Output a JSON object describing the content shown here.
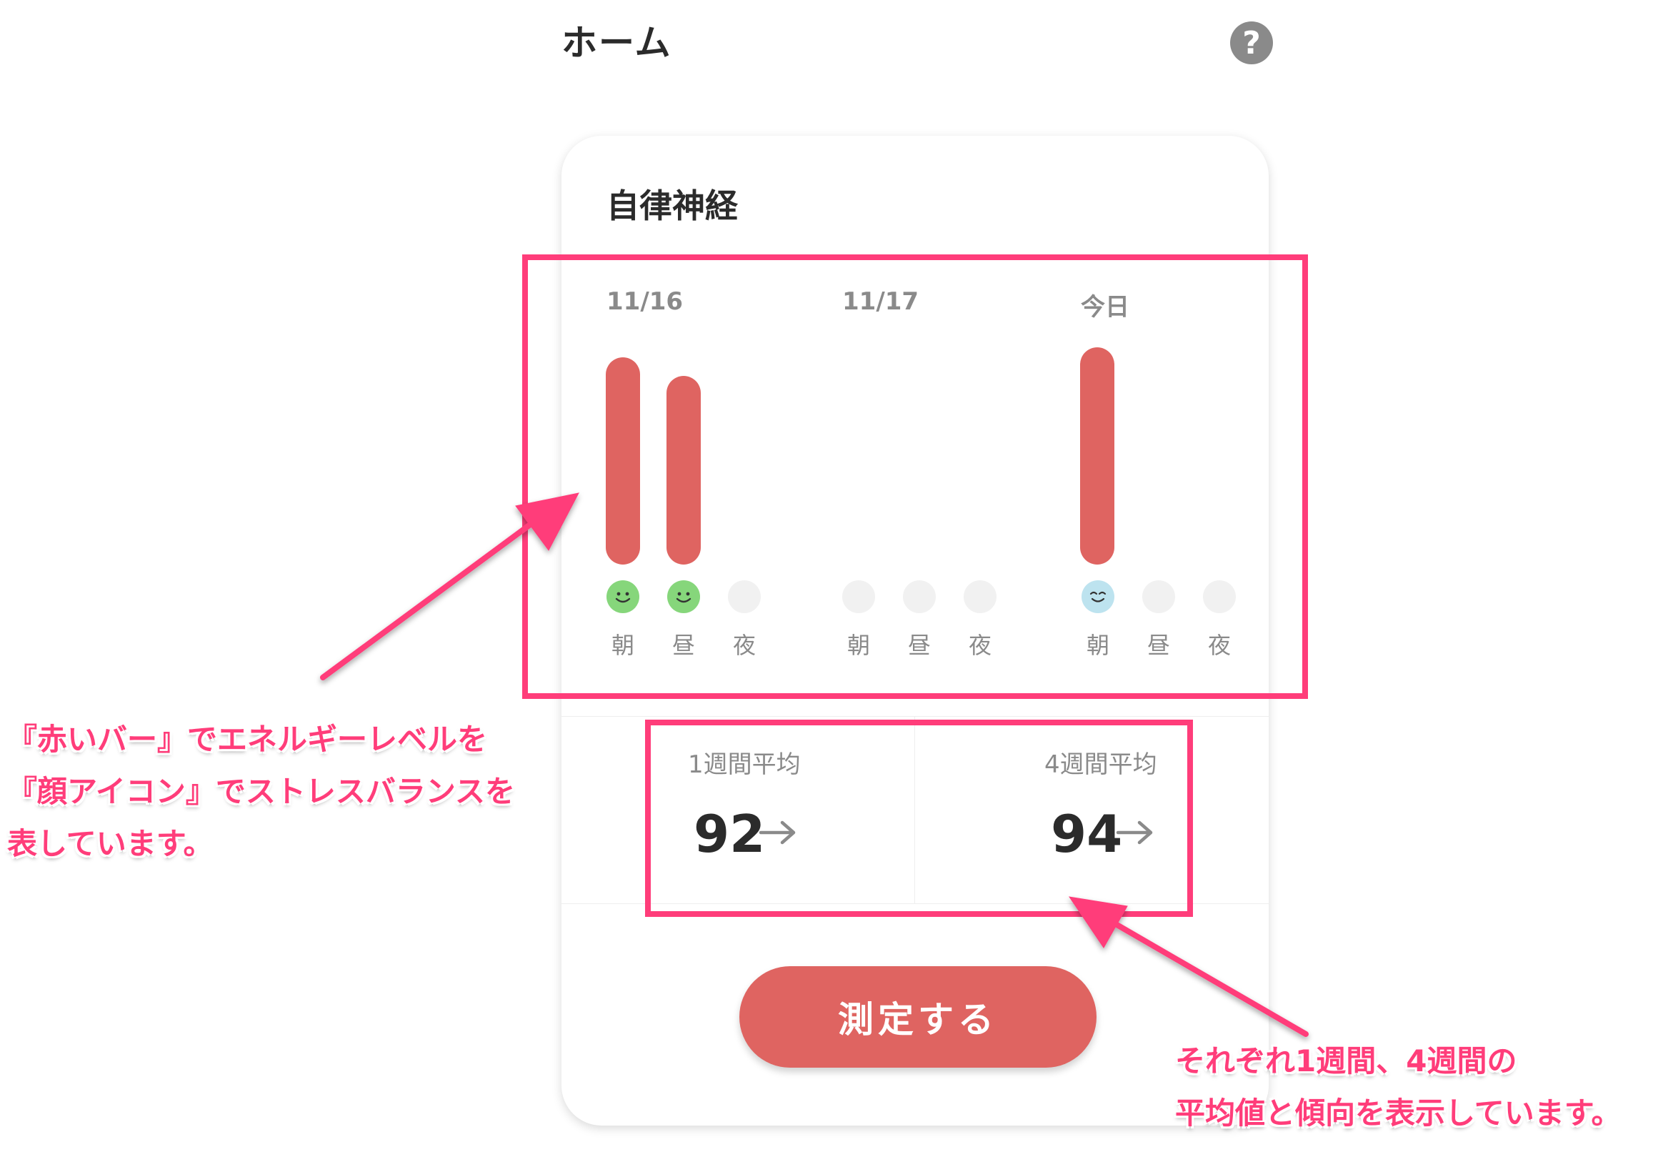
{
  "header": {
    "title": "ホーム",
    "help_icon": "question-circle-icon",
    "help_glyph": "?"
  },
  "card": {
    "title": "自律神経",
    "days": [
      {
        "date": "11/16",
        "energy": {
          "朝": 0.88,
          "昼": 0.8,
          "夜": null
        },
        "mood": {
          "朝": "smile",
          "昼": "smile",
          "夜": "none"
        }
      },
      {
        "date": "11/17",
        "energy": {
          "朝": null,
          "昼": null,
          "夜": null
        },
        "mood": {
          "朝": "none",
          "昼": "none",
          "夜": "none"
        }
      },
      {
        "date": "今日",
        "energy": {
          "朝": 0.92,
          "昼": null,
          "夜": null
        },
        "mood": {
          "朝": "calm",
          "昼": "none",
          "夜": "none"
        }
      }
    ],
    "time_labels": [
      "朝",
      "昼",
      "夜"
    ],
    "weekly": {
      "label": "1週間平均",
      "value": "92",
      "trend_icon": "arrow-right-icon"
    },
    "monthly": {
      "label": "4週間平均",
      "value": "94",
      "trend_icon": "arrow-right-icon"
    },
    "measure_button": "測定する"
  },
  "annotations": {
    "left": [
      "『赤いバー』でエネルギーレベルを",
      "『顔アイコン』でストレスバランスを",
      "表しています。"
    ],
    "right": [
      "それぞれ1週間、4週間の",
      "平均値と傾向を表示しています。"
    ]
  },
  "colors": {
    "accent": "#df6461",
    "annotation": "#ff3d7a",
    "mood_green": "#86d67b",
    "mood_blue": "#bde3ef",
    "empty": "#f1f1f1"
  }
}
